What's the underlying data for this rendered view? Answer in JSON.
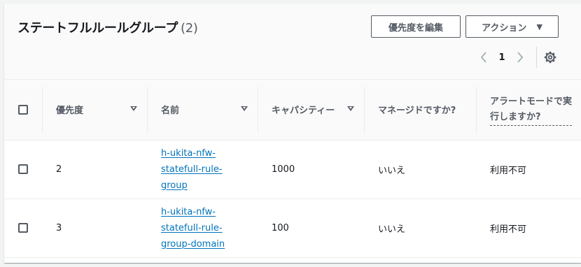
{
  "header": {
    "title": "ステートフルルールグループ",
    "count": "(2)",
    "edit_priority_label": "優先度を編集",
    "actions_label": "アクション"
  },
  "pagination": {
    "current_page": "1",
    "prev_icon": "chevron-left-icon",
    "next_icon": "chevron-right-icon",
    "settings_icon": "gear-icon"
  },
  "table": {
    "columns": {
      "priority": "優先度",
      "name": "名前",
      "capacity": "キャパシティー",
      "managed": "マネージドですか?",
      "alert_mode": "アラートモードで実行しますか?"
    },
    "rows": [
      {
        "priority": "2",
        "name": "h-ukita-nfw-statefull-rule-group",
        "name_lines": [
          "h-ukita-nfw-",
          "statefull-rule-",
          "group"
        ],
        "capacity": "1000",
        "managed": "いいえ",
        "alert_mode": "利用不可"
      },
      {
        "priority": "3",
        "name": "h-ukita-nfw-statefull-rule-group-domain",
        "name_lines": [
          "h-ukita-nfw-",
          "statefull-rule-",
          "group-domain"
        ],
        "capacity": "100",
        "managed": "いいえ",
        "alert_mode": "利用不可"
      }
    ]
  },
  "colors": {
    "link": "#0073bb",
    "header_bg": "#fafafa",
    "text_secondary": "#545b64"
  }
}
